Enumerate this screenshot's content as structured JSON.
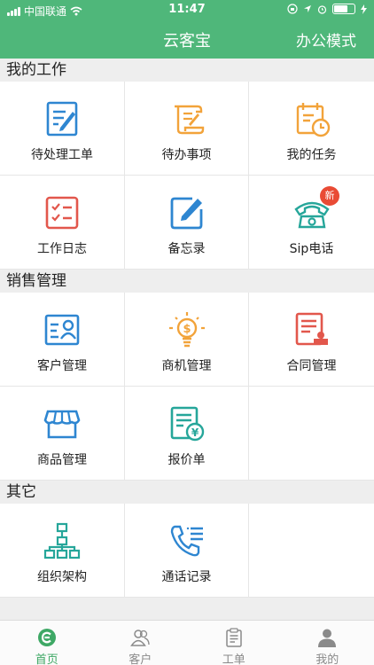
{
  "status": {
    "carrier": "中国联通",
    "time": "11:47"
  },
  "nav": {
    "title": "云客宝",
    "right_label": "办公模式"
  },
  "sections": {
    "work": {
      "title": "我的工作",
      "items": [
        {
          "label": "待处理工单",
          "icon": "edit-document-icon"
        },
        {
          "label": "待办事项",
          "icon": "scroll-icon"
        },
        {
          "label": "我的任务",
          "icon": "calendar-clock-icon"
        },
        {
          "label": "工作日志",
          "icon": "checklist-icon"
        },
        {
          "label": "备忘录",
          "icon": "pencil-square-icon"
        },
        {
          "label": "Sip电话",
          "icon": "telephone-icon",
          "badge": "新"
        }
      ]
    },
    "sales": {
      "title": "销售管理",
      "items": [
        {
          "label": "客户管理",
          "icon": "customer-card-icon"
        },
        {
          "label": "商机管理",
          "icon": "money-bulb-icon"
        },
        {
          "label": "合同管理",
          "icon": "contract-stamp-icon"
        },
        {
          "label": "商品管理",
          "icon": "shop-icon"
        },
        {
          "label": "报价单",
          "icon": "quote-yen-icon"
        }
      ]
    },
    "other": {
      "title": "其它",
      "items": [
        {
          "label": "组织架构",
          "icon": "org-chart-icon"
        },
        {
          "label": "通话记录",
          "icon": "call-log-icon"
        }
      ]
    }
  },
  "tabbar": {
    "tabs": [
      {
        "label": "首页",
        "icon": "home-icon",
        "active": true
      },
      {
        "label": "客户",
        "icon": "customers-icon",
        "active": false
      },
      {
        "label": "工单",
        "icon": "clipboard-icon",
        "active": false
      },
      {
        "label": "我的",
        "icon": "user-icon",
        "active": false
      }
    ]
  },
  "colors": {
    "brand": "#4fb77a",
    "blue": "#2e86d1",
    "orange": "#f2a33a",
    "red": "#e2574c",
    "teal": "#26a69a",
    "badge": "#e94b35"
  }
}
